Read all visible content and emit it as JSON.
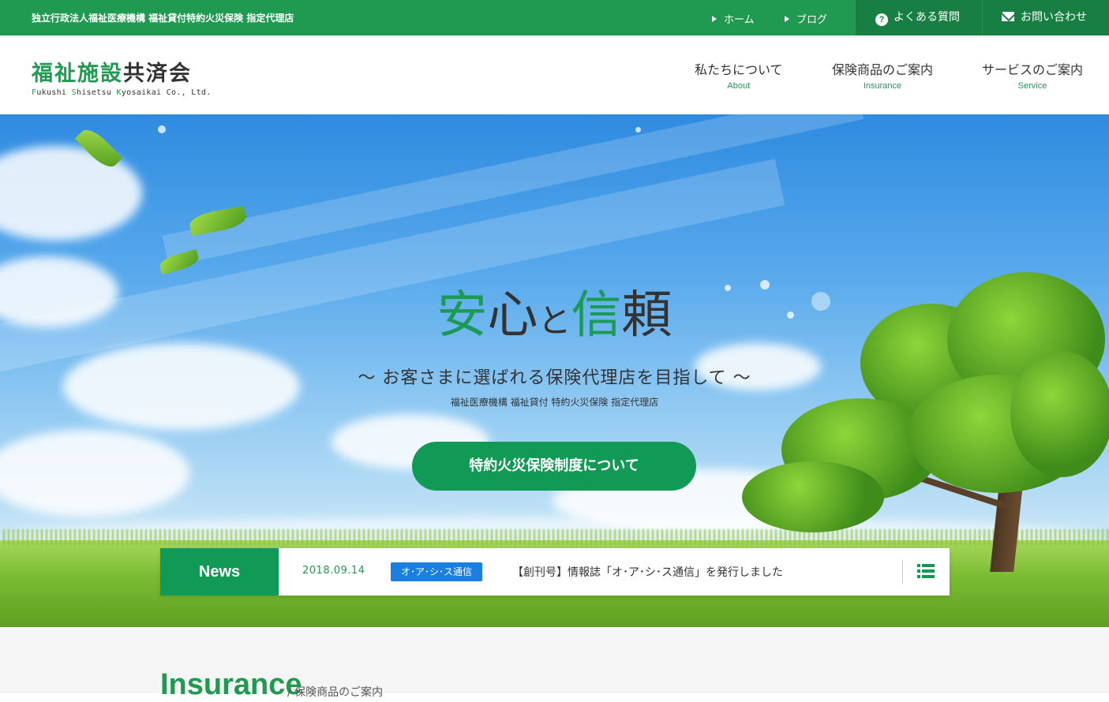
{
  "topbar": {
    "tagline": "独立行政法人福祉医療機構 福祉貸付特約火災保険 指定代理店",
    "links": [
      {
        "label": "ホーム"
      },
      {
        "label": "ブログ"
      }
    ],
    "faq_label": "よくある質問",
    "contact_label": "お問い合わせ"
  },
  "header": {
    "logo_green": "福祉施設",
    "logo_dark": "共済会",
    "logo_en": {
      "f": "F",
      "f_rest": "ukushi ",
      "s": "S",
      "s_rest": "hisetsu ",
      "k": "K",
      "k_rest": "yosaikai Co., Ltd."
    },
    "nav": [
      {
        "jp": "私たちについて",
        "en": "About"
      },
      {
        "jp": "保険商品のご案内",
        "en": "Insurance"
      },
      {
        "jp": "サービスのご案内",
        "en": "Service"
      }
    ]
  },
  "hero": {
    "title_1": "安",
    "title_2": "心",
    "title_3": "と",
    "title_4": "信",
    "title_5": "頼",
    "subtitle": "～ お客さまに選ばれる保険代理店を目指して ～",
    "small": "福祉医療機構 福祉貸付 特約火災保険 指定代理店",
    "cta": "特約火災保険制度について"
  },
  "news": {
    "label": "News",
    "date": "2018.09.14",
    "badge": "オ･ア･シ･ス通信",
    "text": "【創刊号】情報誌「オ･ア･シ･ス通信」を発行しました"
  },
  "section": {
    "title": "Insurance",
    "subtitle": "/  保険商品のご案内"
  },
  "colors": {
    "brand_green": "#1f9a50",
    "button_green": "#119a56",
    "badge_blue": "#1a7fe0"
  }
}
